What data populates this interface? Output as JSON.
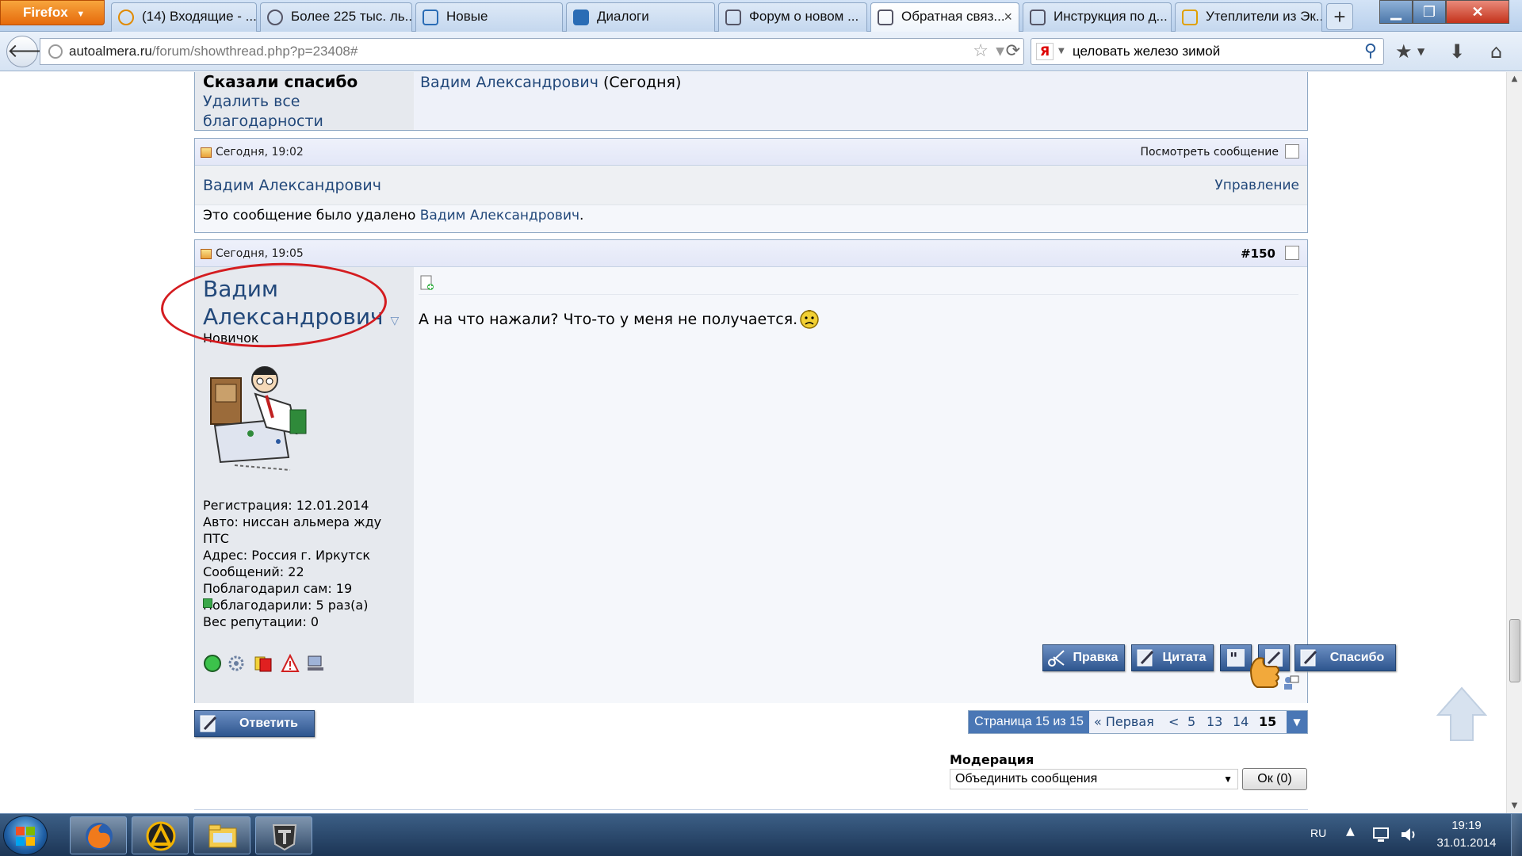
{
  "browser": {
    "menu_button": "Firefox",
    "tabs": [
      {
        "label": "(14) Входящие - ...",
        "icon": "at-icon"
      },
      {
        "label": "Более 225 тыс. ль...",
        "icon": "car-icon"
      },
      {
        "label": "Новые",
        "icon": "chart-icon"
      },
      {
        "label": "Диалоги",
        "icon": "chat-icon"
      },
      {
        "label": "Форум о новом ...",
        "icon": "car-icon"
      },
      {
        "label": "Обратная связ...",
        "icon": "car-icon",
        "active": true
      },
      {
        "label": "Инструкция по д...",
        "icon": "car-icon"
      },
      {
        "label": "Утеплители из Эк...",
        "icon": "house-icon"
      }
    ],
    "new_tab_label": "+",
    "tab_close": "×",
    "url": {
      "domain": "autoalmera.ru",
      "path": "/forum/showthread.php?p=23408#"
    },
    "search": {
      "engine": "Я",
      "query": "целовать железо зимой"
    }
  },
  "thanks_block": {
    "title": "Сказали спасибо",
    "remove_all": "Удалить все благодарности",
    "user": "Вадим Александрович",
    "when": "(Сегодня)"
  },
  "deleted_post": {
    "date": "Сегодня, 19:02",
    "view_label": "Посмотреть сообщение",
    "author": "Вадим Александрович",
    "manage": "Управление",
    "message_prefix": "Это сообщение было удалено",
    "message_user": "Вадим Александрович",
    "message_suffix": "."
  },
  "post": {
    "date": "Сегодня, 19:05",
    "number": "#150",
    "author": "Вадим Александрович",
    "rank": "Новичок",
    "info": [
      "Регистрация: 12.01.2014",
      "Авто: ниссан альмера жду ПТС",
      "Адрес: Россия г. Иркутск",
      "Сообщений: 22",
      "Поблагодарил сам: 19",
      "Поблагодарили: 5 раз(а)",
      "Вес репутации: 0"
    ],
    "text": "А на что нажали? Что-то у меня не получается.",
    "buttons": {
      "edit": "Правка",
      "quote": "Цитата",
      "thanks": "Спасибо"
    }
  },
  "reply_button": "Ответить",
  "pagination": {
    "info": "Страница 15 из 15",
    "first": "« Первая",
    "prev": "<",
    "pages": [
      "5",
      "13",
      "14"
    ],
    "current": "15"
  },
  "moderation": {
    "label": "Модерация",
    "selected": "Объединить сообщения",
    "ok": "Ок (0)"
  },
  "taskbar": {
    "lang": "RU",
    "time": "19:19",
    "date": "31.01.2014"
  },
  "colors": {
    "link": "#22487a",
    "button_blue": "#2d558e",
    "annotation_red": "#d41c20"
  }
}
